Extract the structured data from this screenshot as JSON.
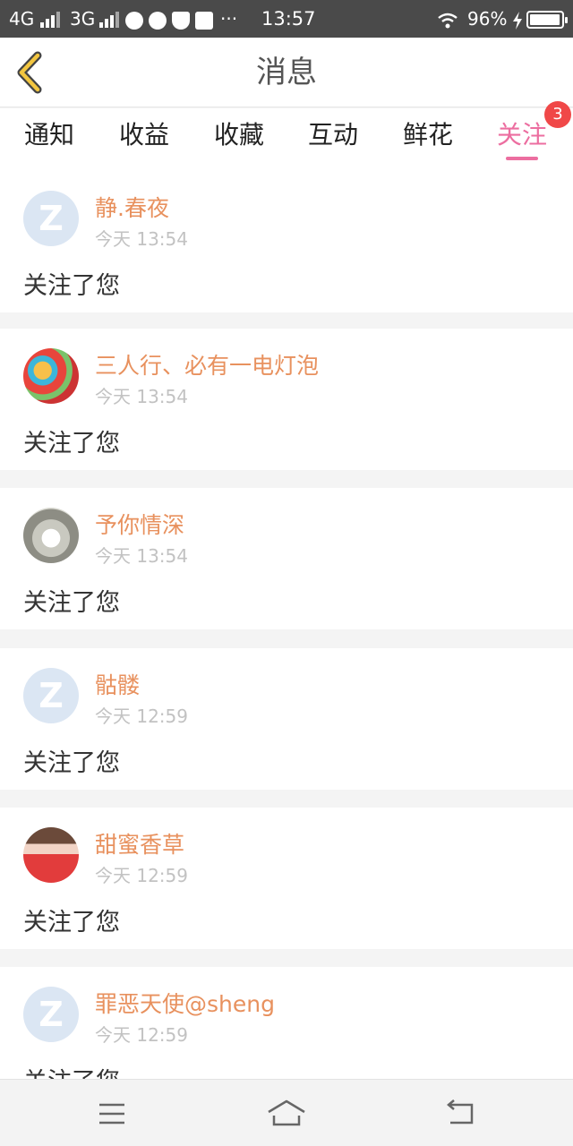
{
  "status_bar": {
    "network1": "4G",
    "network2": "3G",
    "more": "···",
    "time": "13:57",
    "battery": "96%",
    "battery_level": 0.96
  },
  "header": {
    "title": "消息"
  },
  "tabs": [
    {
      "label": "通知"
    },
    {
      "label": "收益"
    },
    {
      "label": "收藏"
    },
    {
      "label": "互动"
    },
    {
      "label": "鲜花"
    },
    {
      "label": "关注",
      "active": true,
      "badge": "3"
    }
  ],
  "items": [
    {
      "name": "静.春夜",
      "time": "今天 13:54",
      "message": "关注了您",
      "avatar": "default-avatar"
    },
    {
      "name": "三人行、必有一电灯泡",
      "time": "今天 13:54",
      "message": "关注了您",
      "avatar": "cake-photo-avatar"
    },
    {
      "name": "予你情深",
      "time": "今天 13:54",
      "message": "关注了您",
      "avatar": "cat-photo-avatar"
    },
    {
      "name": "骷髅",
      "time": "今天 12:59",
      "message": "关注了您",
      "avatar": "default-avatar"
    },
    {
      "name": "甜蜜香草",
      "time": "今天 12:59",
      "message": "关注了您",
      "avatar": "woman-photo-avatar"
    },
    {
      "name": "罪恶天使@sheng",
      "time": "今天 12:59",
      "message": "关注了您",
      "avatar": "default-avatar"
    }
  ],
  "nav": {
    "menu_icon": "menu-icon",
    "home_icon": "home-icon",
    "back_icon": "return-icon"
  },
  "colors": {
    "accent": "#ec6ea0",
    "name": "#e8915e",
    "badge": "#f04848",
    "status_bar": "#4a4a4a"
  }
}
